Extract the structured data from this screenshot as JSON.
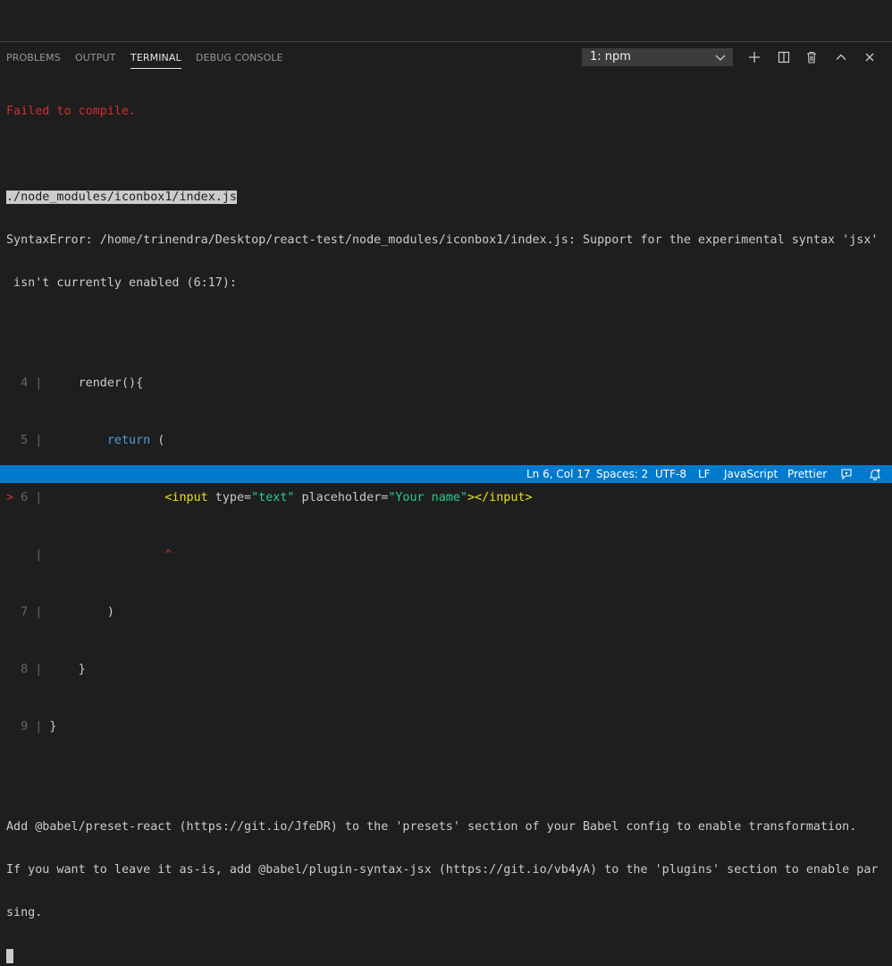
{
  "panel": {
    "tabs": [
      {
        "label": "PROBLEMS"
      },
      {
        "label": "OUTPUT"
      },
      {
        "label": "TERMINAL"
      },
      {
        "label": "DEBUG CONSOLE"
      }
    ],
    "active_tab": "TERMINAL",
    "terminal_select": {
      "value": "1: npm"
    },
    "actions": [
      {
        "icon": "plus-icon",
        "title": "New Terminal"
      },
      {
        "icon": "split-icon",
        "title": "Split Terminal"
      },
      {
        "icon": "trash-icon",
        "title": "Kill Terminal"
      },
      {
        "icon": "chevron-up-icon",
        "title": "Maximize Panel"
      },
      {
        "icon": "close-icon",
        "title": "Close Panel"
      }
    ]
  },
  "terminal": {
    "failed": "Failed to compile.",
    "file_path": "./node_modules/iconbox1/index.js",
    "error_line1": "SyntaxError: /home/trinendra/Desktop/react-test/node_modules/iconbox1/index.js: Support for the experimental syntax 'jsx'",
    "error_line2": " isn't currently enabled (6:17):",
    "code": {
      "l4_num": "4",
      "l4_code": "     render(){",
      "l5_num": "5",
      "l5_kw": "return",
      "l5_rest": " (",
      "l6_marker": ">",
      "l6_num": "6",
      "l6_tag_open": "<input",
      "l6_attr1": " type=",
      "l6_val1": "\"text\"",
      "l6_attr2": " placeholder=",
      "l6_val2": "\"Your name\"",
      "l6_tag_close": "></input>",
      "caret": "^",
      "l7_num": "7",
      "l7_code": "         )",
      "l8_num": "8",
      "l8_code": "     }",
      "l9_num": "9",
      "l9_code": " }",
      "bar": "|"
    },
    "hint_line1": "Add @babel/preset-react (https://git.io/JfeDR) to the 'presets' section of your Babel config to enable transformation.",
    "hint_line2": "If you want to leave it as-is, add @babel/plugin-syntax-jsx (https://git.io/vb4yA) to the 'plugins' section to enable par",
    "hint_line3": "sing."
  },
  "statusbar": {
    "position": "Ln 6, Col 17",
    "spaces": "Spaces: 2",
    "encoding": "UTF-8",
    "eol": "LF",
    "language": "JavaScript",
    "formatter": "Prettier"
  },
  "colors": {
    "statusbar_bg": "#007acc",
    "error_red": "#cd3131",
    "background": "#1e1e1e"
  }
}
